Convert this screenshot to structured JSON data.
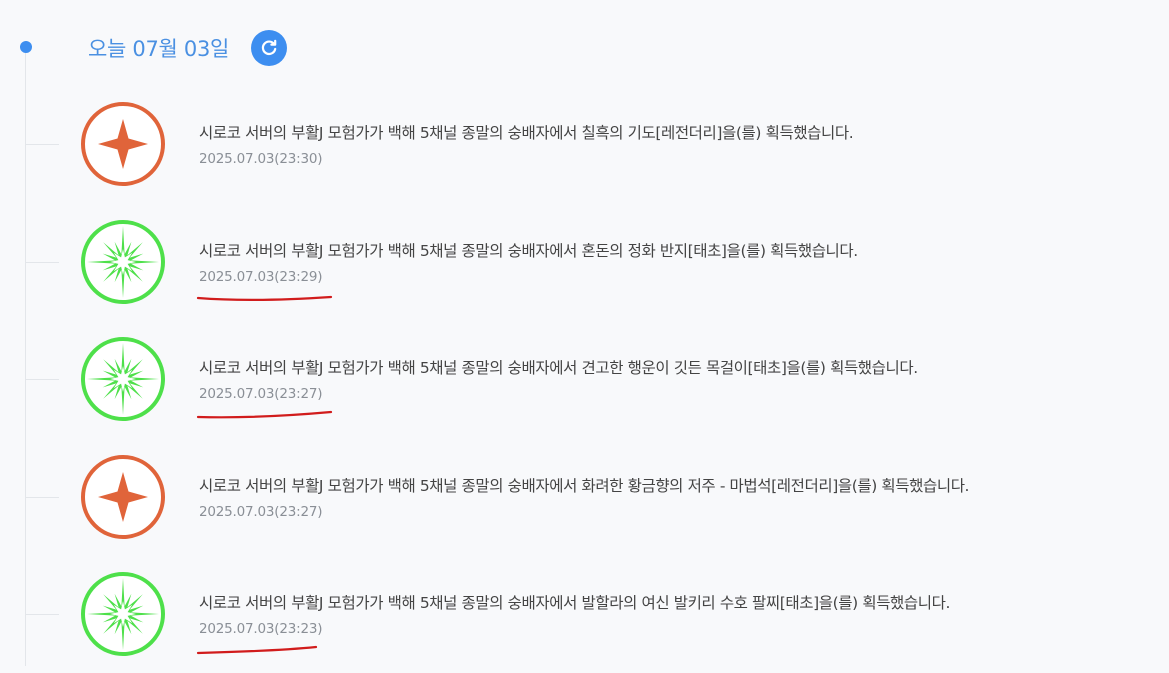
{
  "header": {
    "date_label": "오늘 07월 03일",
    "refresh_icon": "refresh-icon",
    "accent_color": "#3d8ef0"
  },
  "colors": {
    "legendary": "#e0643a",
    "epic": "#4ee04a"
  },
  "feed": [
    {
      "message": "시로코 서버의 부활J 모험가가 백해 5채널 종말의 숭배자에서 칠흑의 기도[레전더리]을(를) 획득했습니다.",
      "time": "2025.07.03(23:30)",
      "icon": "legendary-icon",
      "grade": "legendary",
      "underlined": false
    },
    {
      "message": "시로코 서버의 부활J 모험가가 백해 5채널 종말의 숭배자에서 혼돈의 정화 반지[태초]을(를) 획득했습니다.",
      "time": "2025.07.03(23:29)",
      "icon": "primeval-icon",
      "grade": "primeval",
      "underlined": true
    },
    {
      "message": "시로코 서버의 부활J 모험가가 백해 5채널 종말의 숭배자에서 견고한 행운이 깃든 목걸이[태초]을(를) 획득했습니다.",
      "time": "2025.07.03(23:27)",
      "icon": "primeval-icon",
      "grade": "primeval",
      "underlined": true
    },
    {
      "message": "시로코 서버의 부활J 모험가가 백해 5채널 종말의 숭배자에서 화려한 황금향의 저주 - 마법석[레전더리]을(를) 획득했습니다.",
      "time": "2025.07.03(23:27)",
      "icon": "legendary-icon",
      "grade": "legendary",
      "underlined": false
    },
    {
      "message": "시로코 서버의 부활J 모험가가 백해 5채널 종말의 숭배자에서 발할라의 여신 발키리 수호 팔찌[태초]을(를) 획득했습니다.",
      "time": "2025.07.03(23:23)",
      "icon": "primeval-icon",
      "grade": "primeval",
      "underlined": true
    }
  ]
}
